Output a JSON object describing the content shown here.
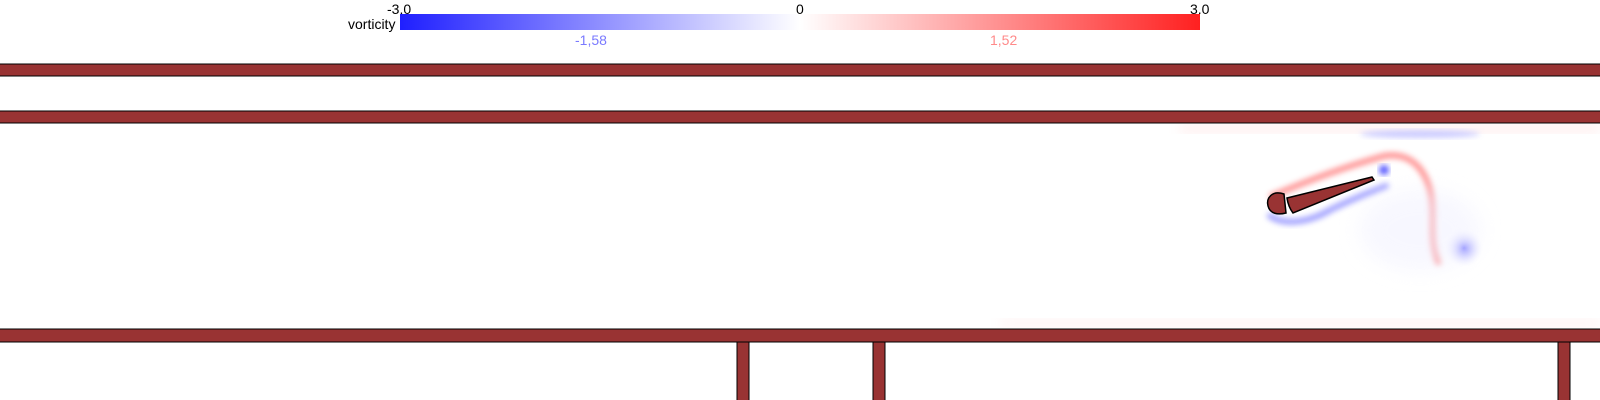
{
  "colorbar": {
    "label": "vorticity",
    "min_label": "-3.0",
    "mid_label": "0",
    "max_label": "3.0",
    "neg_marker": "-1,58",
    "pos_marker": "1,52",
    "neg_color": "#1f1fff",
    "mid_color": "#ffffff",
    "pos_color": "#ff2020",
    "neg_marker_color": "#7a7aff",
    "pos_marker_color": "#ff8a8a"
  },
  "structure_color": "#993333",
  "outline_color": "#000000"
}
